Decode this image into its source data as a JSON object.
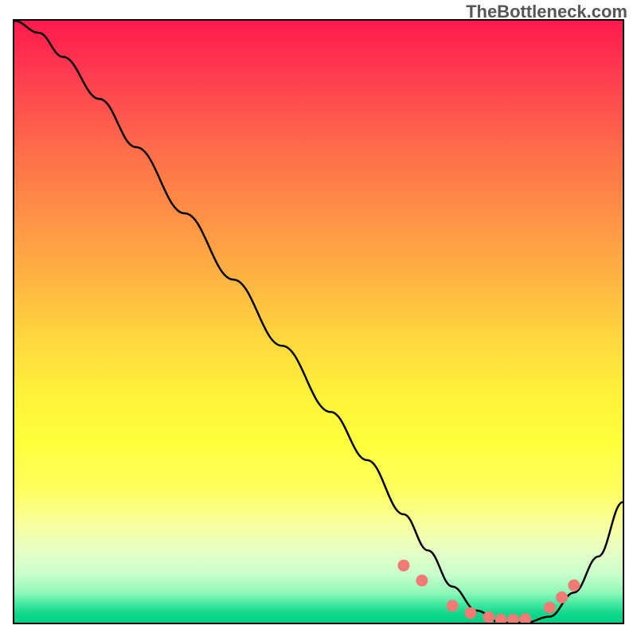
{
  "watermark": "TheBottleneck.com",
  "chart_data": {
    "type": "line",
    "title": "",
    "xlabel": "",
    "ylabel": "",
    "xlim": [
      0,
      100
    ],
    "ylim": [
      0,
      100
    ],
    "grid": false,
    "series": [
      {
        "name": "curve",
        "x": [
          0,
          4,
          8,
          14,
          20,
          28,
          36,
          44,
          52,
          58,
          64,
          68,
          72,
          76,
          80,
          84,
          88,
          92,
          96,
          100
        ],
        "y": [
          100,
          98,
          94,
          87,
          79,
          68,
          57,
          46,
          35,
          27,
          18,
          12,
          6,
          2,
          0,
          0,
          1,
          5,
          11,
          20
        ]
      }
    ],
    "markers": {
      "x": [
        64,
        67,
        72,
        75,
        78,
        80,
        82,
        84,
        88,
        90,
        92
      ],
      "y": [
        9.5,
        7,
        2.8,
        1.6,
        0.9,
        0.5,
        0.5,
        0.6,
        2.5,
        4.2,
        6.2
      ]
    },
    "gradient_stops": [
      {
        "pos": 0,
        "color": "#ff1a4d"
      },
      {
        "pos": 50,
        "color": "#ffd43e"
      },
      {
        "pos": 75,
        "color": "#ffff3c"
      },
      {
        "pos": 100,
        "color": "#00cf85"
      }
    ]
  }
}
